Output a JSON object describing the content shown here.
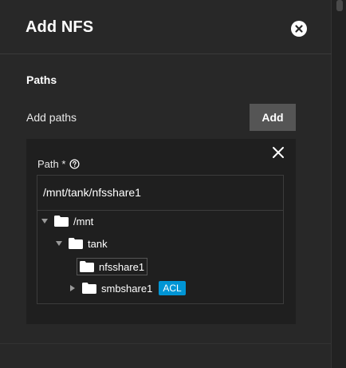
{
  "dialog": {
    "title": "Add NFS"
  },
  "paths_section": {
    "title": "Paths",
    "add_paths_label": "Add paths",
    "add_button_label": "Add"
  },
  "path_field": {
    "label": "Path *",
    "value": "/mnt/tank/nfsshare1"
  },
  "tree": {
    "nodes": [
      {
        "label": "/mnt",
        "expanded": true,
        "depth": 0
      },
      {
        "label": "tank",
        "expanded": true,
        "depth": 1
      },
      {
        "label": "nfsshare1",
        "selected": true,
        "depth": 2
      },
      {
        "label": "smbshare1",
        "expanded": false,
        "depth": 2,
        "badge": "ACL"
      }
    ]
  },
  "colors": {
    "background": "#282828",
    "card": "#1f1f1f",
    "button": "#555555",
    "badge": "#0095d5"
  },
  "icons": [
    "close-circle-icon",
    "close-icon",
    "help-icon",
    "folder-icon",
    "caret-down-icon",
    "caret-right-icon"
  ]
}
